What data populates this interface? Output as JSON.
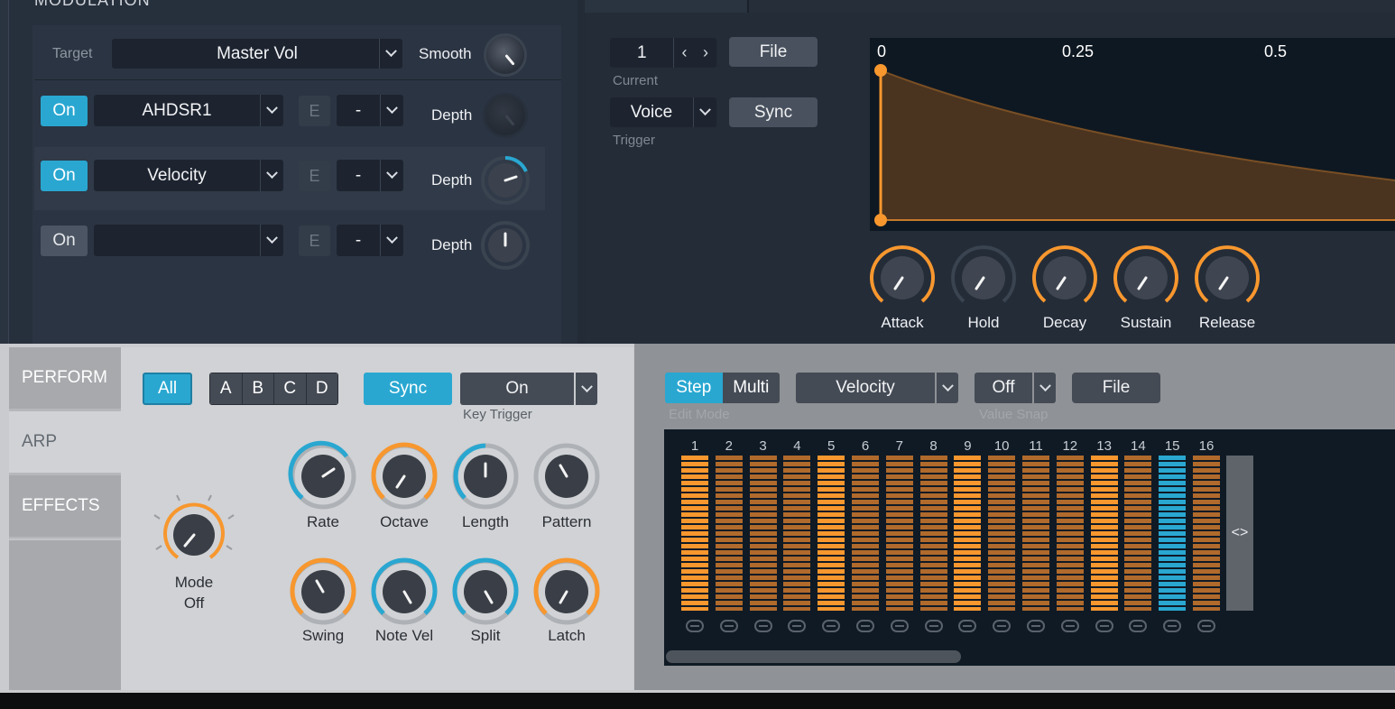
{
  "modulation": {
    "title": "MODULATION",
    "target_label": "Target",
    "target_value": "Master Vol",
    "smooth_label": "Smooth",
    "rows": [
      {
        "on_label": "On",
        "on_active": true,
        "source": "AHDSR1",
        "e_label": "E",
        "via": "-",
        "depth_label": "Depth"
      },
      {
        "on_label": "On",
        "on_active": true,
        "source": "Velocity",
        "e_label": "E",
        "via": "-",
        "depth_label": "Depth"
      },
      {
        "on_label": "On",
        "on_active": false,
        "source": "",
        "e_label": "E",
        "via": "-",
        "depth_label": "Depth"
      }
    ]
  },
  "envelope": {
    "current_value": "1",
    "current_label": "Current",
    "file_label": "File",
    "trigger_value": "Voice",
    "trigger_label": "Trigger",
    "sync_label": "Sync",
    "time_ticks": [
      "0",
      "0.25",
      "0.5"
    ],
    "knobs": [
      "Attack",
      "Hold",
      "Decay",
      "Sustain",
      "Release"
    ]
  },
  "sidebar": {
    "tabs": [
      {
        "label": "PERFORM",
        "active": false
      },
      {
        "label": "ARP",
        "active": true
      },
      {
        "label": "EFFECTS",
        "active": false
      }
    ]
  },
  "arp": {
    "all_label": "All",
    "groups": [
      "A",
      "B",
      "C",
      "D"
    ],
    "sync_label": "Sync",
    "key_trigger_value": "On",
    "key_trigger_label": "Key Trigger",
    "mode_label": "Mode",
    "mode_value": "Off",
    "knobs_row1": [
      "Rate",
      "Octave",
      "Length",
      "Pattern"
    ],
    "knobs_row2": [
      "Swing",
      "Note Vel",
      "Split",
      "Latch"
    ]
  },
  "sequencer": {
    "step_label": "Step",
    "multi_label": "Multi",
    "edit_mode_label": "Edit Mode",
    "param_value": "Velocity",
    "snap_value": "Off",
    "value_snap_label": "Value Snap",
    "file_label": "File",
    "steps": [
      "1",
      "2",
      "3",
      "4",
      "5",
      "6",
      "7",
      "8",
      "9",
      "10",
      "11",
      "12",
      "13",
      "14",
      "15",
      "16"
    ],
    "accent_steps": [
      1,
      5,
      9,
      13
    ],
    "selected_step": 15,
    "scroll_icon": "<>"
  },
  "colors": {
    "accent_orange": "#f7972e",
    "accent_blue": "#29a7d1",
    "step_dim": "#b06a2c"
  }
}
